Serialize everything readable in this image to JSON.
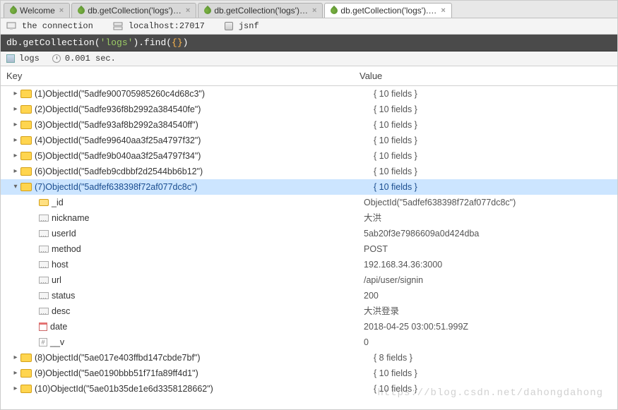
{
  "tabs": [
    {
      "label": "Welcome",
      "active": false
    },
    {
      "label": "db.getCollection('logs')…",
      "active": false
    },
    {
      "label": "db.getCollection('logs')…",
      "active": false
    },
    {
      "label": "db.getCollection('logs').…",
      "active": true
    }
  ],
  "connection": {
    "label": "the connection",
    "host": "localhost:27017",
    "db": "jsnf"
  },
  "query": {
    "prefix": "db.getCollection(",
    "collection": "'logs'",
    "suffix": ").find(",
    "args": "{}",
    "close": ")"
  },
  "status": {
    "collection": "logs",
    "time": "0.001 sec."
  },
  "columns": {
    "key": "Key",
    "value": "Value"
  },
  "docs": [
    {
      "idx": "(1)",
      "id": "ObjectId(\"5adfe900705985260c4d68c3\")",
      "summary": "{ 10 fields }",
      "expanded": false
    },
    {
      "idx": "(2)",
      "id": "ObjectId(\"5adfe936f8b2992a384540fe\")",
      "summary": "{ 10 fields }",
      "expanded": false
    },
    {
      "idx": "(3)",
      "id": "ObjectId(\"5adfe93af8b2992a384540ff\")",
      "summary": "{ 10 fields }",
      "expanded": false
    },
    {
      "idx": "(4)",
      "id": "ObjectId(\"5adfe99640aa3f25a4797f32\")",
      "summary": "{ 10 fields }",
      "expanded": false
    },
    {
      "idx": "(5)",
      "id": "ObjectId(\"5adfe9b040aa3f25a4797f34\")",
      "summary": "{ 10 fields }",
      "expanded": false
    },
    {
      "idx": "(6)",
      "id": "ObjectId(\"5adfeb9cdbbf2d2544bb6b12\")",
      "summary": "{ 10 fields }",
      "expanded": false
    },
    {
      "idx": "(7)",
      "id": "ObjectId(\"5adfef638398f72af077dc8c\")",
      "summary": "{ 10 fields }",
      "expanded": true,
      "selected": true,
      "fields": [
        {
          "icon": "sm",
          "key": "_id",
          "value": "ObjectId(\"5adfef638398f72af077dc8c\")"
        },
        {
          "icon": "fld",
          "key": "nickname",
          "value": "大洪"
        },
        {
          "icon": "fld",
          "key": "userId",
          "value": "5ab20f3e7986609a0d424dba"
        },
        {
          "icon": "fld",
          "key": "method",
          "value": "POST"
        },
        {
          "icon": "fld",
          "key": "host",
          "value": "192.168.34.36:3000"
        },
        {
          "icon": "fld",
          "key": "url",
          "value": "/api/user/signin"
        },
        {
          "icon": "fld",
          "key": "status",
          "value": "200"
        },
        {
          "icon": "fld",
          "key": "desc",
          "value": "大洪登录"
        },
        {
          "icon": "cal",
          "key": "date",
          "value": "2018-04-25 03:00:51.999Z"
        },
        {
          "icon": "hash",
          "key": "__v",
          "value": "0"
        }
      ]
    },
    {
      "idx": "(8)",
      "id": "ObjectId(\"5ae017e403ffbd147cbde7bf\")",
      "summary": "{ 8 fields }",
      "expanded": false
    },
    {
      "idx": "(9)",
      "id": "ObjectId(\"5ae0190bbb51f71fa89ff4d1\")",
      "summary": "{ 10 fields }",
      "expanded": false
    },
    {
      "idx": "(10)",
      "id": "ObjectId(\"5ae01b35de1e6d3358128662\")",
      "summary": "{ 10 fields }",
      "expanded": false
    }
  ],
  "watermark": "https://blog.csdn.net/dahongdahong"
}
